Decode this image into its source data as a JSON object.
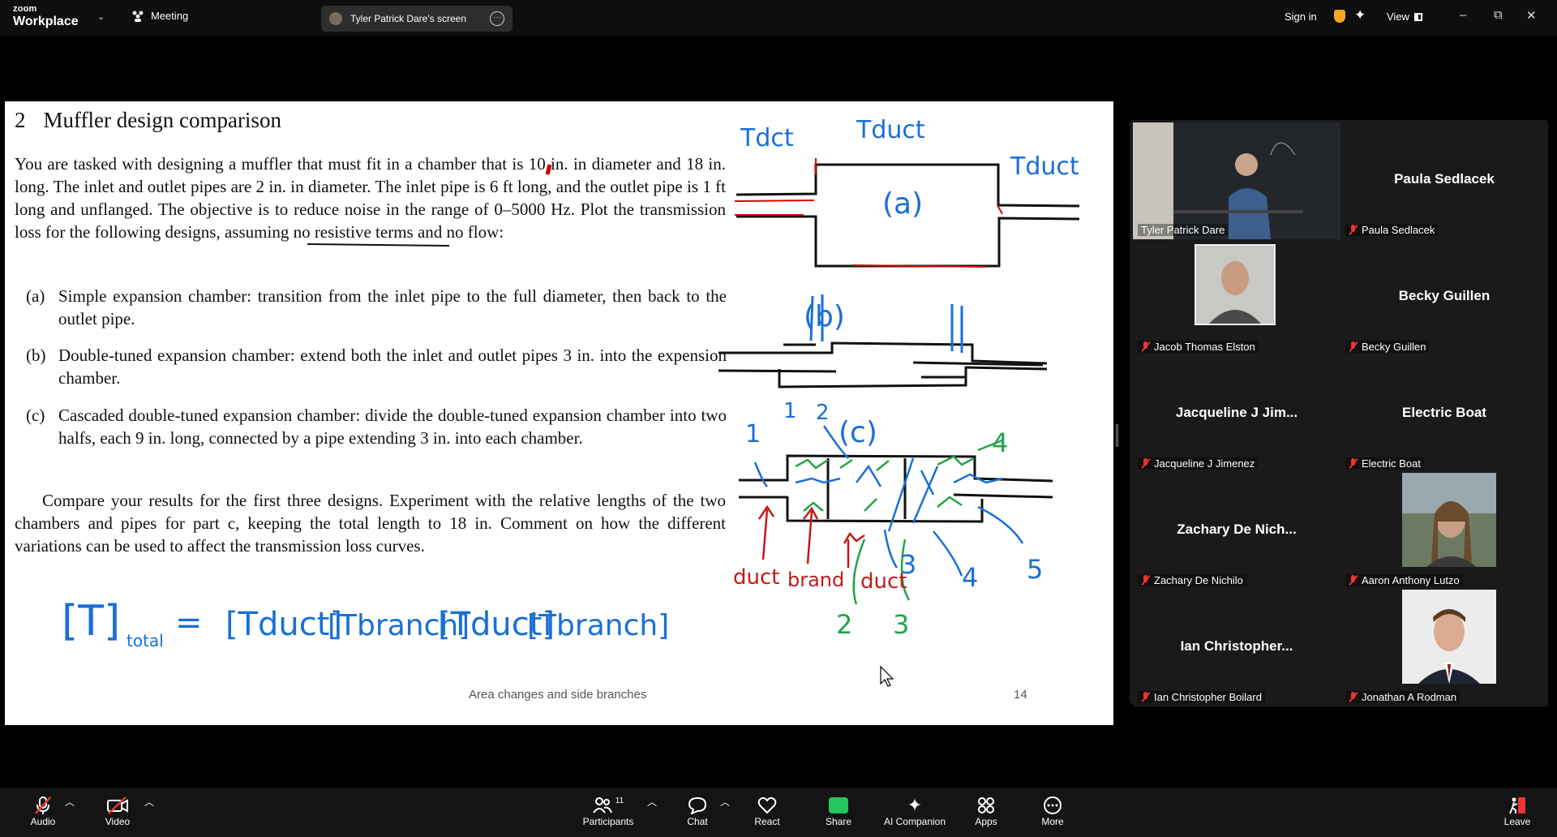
{
  "topbar": {
    "logo_line1": "zoom",
    "logo_line2": "Workplace",
    "meeting_label": "Meeting",
    "share_label": "Tyler Patrick Dare's screen",
    "signin": "Sign in",
    "view": "View",
    "minimize": "–",
    "restore": "⧉",
    "close": "✕"
  },
  "slide": {
    "section_number": "2",
    "section_title": "Muffler design comparison",
    "body": "You are tasked with designing a muffler that must fit in a chamber that is 10 in. in diameter and 18 in. long. The inlet and outlet pipes are 2 in. in diameter. The inlet pipe is 6 ft long, and the outlet pipe is 1 ft long and unflanged. The objective is to reduce noise in the range of 0–5000 Hz. Plot the transmission loss for the following designs, assuming no resistive terms and no flow:",
    "items": [
      {
        "label": "(a)",
        "text": "Simple expansion chamber: transition from the inlet pipe to the full diameter, then back to the outlet pipe."
      },
      {
        "label": "(b)",
        "text": "Double-tuned expansion chamber: extend both the inlet and outlet pipes 3 in. into the expension chamber."
      },
      {
        "label": "(c)",
        "text": "Cascaded double-tuned expansion chamber: divide the double-tuned expansion chamber into two halfs, each 9 in. long, connected by a pipe extending 3 in. into each chamber."
      }
    ],
    "compare": "Compare your results for the first three designs. Experiment with the relative lengths of the two chambers and pipes for part c, keeping the total length to 18 in. Comment on how the different variations can be used to affect the transmission loss curves.",
    "footer": "Area changes and side branches",
    "page": "14",
    "ink": {
      "tdct": "Tdct",
      "tduct": "Tduct",
      "a": "(a)",
      "b": "(b)",
      "c": "(c)",
      "n1": "1",
      "n2": "2",
      "n3": "3",
      "n4": "4",
      "n5": "5",
      "g4": "4",
      "g2": "2",
      "g3": "3",
      "duct": "duct",
      "brand": "brand",
      "eq_T": "[T]",
      "eq_total": "total",
      "eq_eq": "=",
      "eq_terms": [
        "[Tduct]",
        "[Tbranch]",
        "[Tduct]",
        "[Tbranch]"
      ]
    }
  },
  "participants": [
    {
      "big": "",
      "label": "Tyler Patrick Dare",
      "muted": false,
      "video": true
    },
    {
      "big": "Paula Sedlacek",
      "label": "Paula Sedlacek",
      "muted": true
    },
    {
      "big": "",
      "label": "Jacob Thomas Elston",
      "muted": true,
      "photo": true
    },
    {
      "big": "Becky Guillen",
      "label": "Becky Guillen",
      "muted": true
    },
    {
      "big": "Jacqueline J Jim...",
      "label": "Jacqueline J Jimenez",
      "muted": true
    },
    {
      "big": "Electric Boat",
      "label": "Electric Boat",
      "muted": true
    },
    {
      "big": "Zachary De Nich...",
      "label": "Zachary De Nichilo",
      "muted": true
    },
    {
      "big": "",
      "label": "Aaron Anthony Lutzo",
      "muted": true,
      "photo": true
    },
    {
      "big": "Ian Christopher...",
      "label": "Ian Christopher Boilard",
      "muted": true
    },
    {
      "big": "",
      "label": "Jonathan A Rodman",
      "muted": true,
      "photo": true
    }
  ],
  "toolbar": {
    "audio": "Audio",
    "video": "Video",
    "participants": "Participants",
    "participants_count": "11",
    "chat": "Chat",
    "react": "React",
    "share": "Share",
    "ai_companion": "AI Companion",
    "apps": "Apps",
    "more": "More",
    "leave": "Leave"
  }
}
